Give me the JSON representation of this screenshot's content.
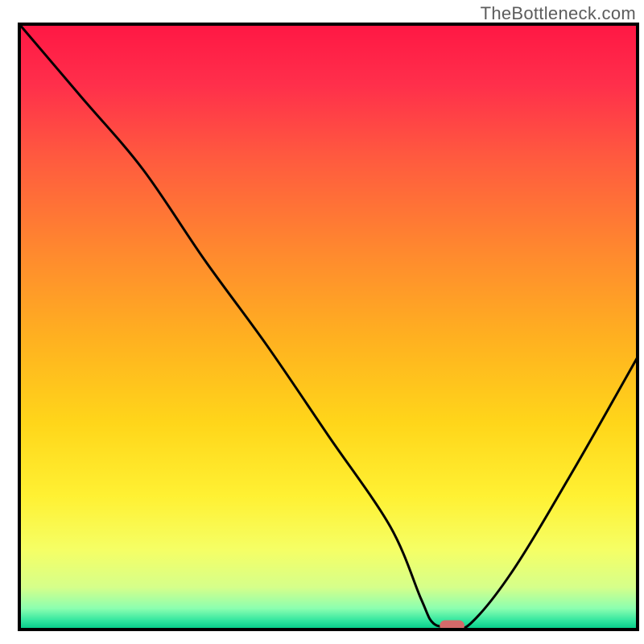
{
  "watermark": "TheBottleneck.com",
  "chart_data": {
    "type": "line",
    "title": "",
    "xlabel": "",
    "ylabel": "",
    "xlim": [
      0,
      100
    ],
    "ylim": [
      0,
      100
    ],
    "x": [
      0,
      10,
      20,
      30,
      40,
      50,
      60,
      65,
      67,
      70,
      73,
      80,
      90,
      100
    ],
    "values": [
      100,
      88,
      76,
      61,
      47,
      32,
      17,
      5,
      1,
      0.5,
      1,
      10,
      27,
      45
    ],
    "marker": {
      "x": 70,
      "y": 0,
      "width": 4,
      "height": 1.8,
      "color": "#d46a6a"
    },
    "gradient_stops": [
      {
        "offset": 0.0,
        "color": "#ff1744"
      },
      {
        "offset": 0.1,
        "color": "#ff2f4b"
      },
      {
        "offset": 0.22,
        "color": "#ff5a3f"
      },
      {
        "offset": 0.38,
        "color": "#ff8a2e"
      },
      {
        "offset": 0.52,
        "color": "#ffb120"
      },
      {
        "offset": 0.66,
        "color": "#ffd61a"
      },
      {
        "offset": 0.78,
        "color": "#fff133"
      },
      {
        "offset": 0.87,
        "color": "#f5ff66"
      },
      {
        "offset": 0.93,
        "color": "#d6ff8a"
      },
      {
        "offset": 0.965,
        "color": "#8cffb0"
      },
      {
        "offset": 0.985,
        "color": "#33e6a0"
      },
      {
        "offset": 1.0,
        "color": "#00c987"
      }
    ],
    "curve_color": "#000000",
    "border_color": "#000000"
  }
}
